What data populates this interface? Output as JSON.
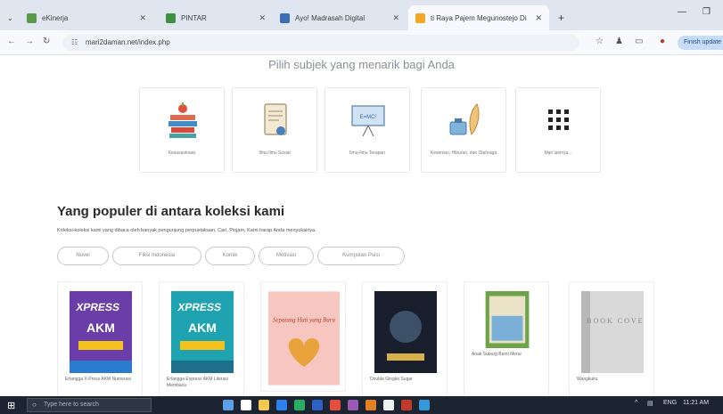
{
  "browser": {
    "tabs": [
      {
        "label": "eKinerja",
        "color": "#5a9b4a"
      },
      {
        "label": "PINTAR",
        "color": "#3d9140"
      },
      {
        "label": "Ayo! Madrasah Digital",
        "color": "#3b6fb5"
      },
      {
        "label": "ti Raya Pajem Megunostejo Di",
        "color": "#f5a623"
      }
    ],
    "new_tab": "+",
    "url": "mari2daman.net/index.php",
    "finish_update": "Finish update"
  },
  "page": {
    "heading": "Pilih subjek yang menarik bagi Anda",
    "subjects": [
      {
        "label": "Kesusastraan"
      },
      {
        "label": "Ilmu Ilmu Sosial"
      },
      {
        "label": "Ilmu-Ilmu Terapan"
      },
      {
        "label": "Kesenian, Hiburan, dan Olahraga"
      },
      {
        "label": "Mari lainnya..."
      }
    ],
    "popular_title": "Yang populer di antara koleksi kami",
    "popular_desc": "Koleksi-koleksi kami yang dibaca oleh banyak pengunjung perpustakaan. Cari, Pinjam, Kami harap Anda menyukainya.",
    "filters": [
      "Novel",
      "Fiksi Indonesia",
      "Komik",
      "Motivasi",
      "Kumpulan Puisi"
    ],
    "books": [
      {
        "title": "Erlangga X-Press AKM Numerasi",
        "cover_text": "AKM",
        "brand": "XPRESS"
      },
      {
        "title": "Erlangga Express AKM Literasi Membaca",
        "cover_text": "AKM",
        "brand": "XPRESS"
      },
      {
        "title": "",
        "cover_text": "Sepatang Hati yang Baru",
        "brand": ""
      },
      {
        "title": "Double Gingko Sugar",
        "cover_text": "",
        "brand": ""
      },
      {
        "title": "Anak Suburg Bumi Merai",
        "cover_text": "",
        "brand": ""
      },
      {
        "title": "Wangkuku",
        "cover_text": "BOOK COVER",
        "brand": ""
      }
    ]
  },
  "taskbar": {
    "search_placeholder": "Type here to search",
    "lang": "ENG",
    "time": "11:21 AM"
  }
}
